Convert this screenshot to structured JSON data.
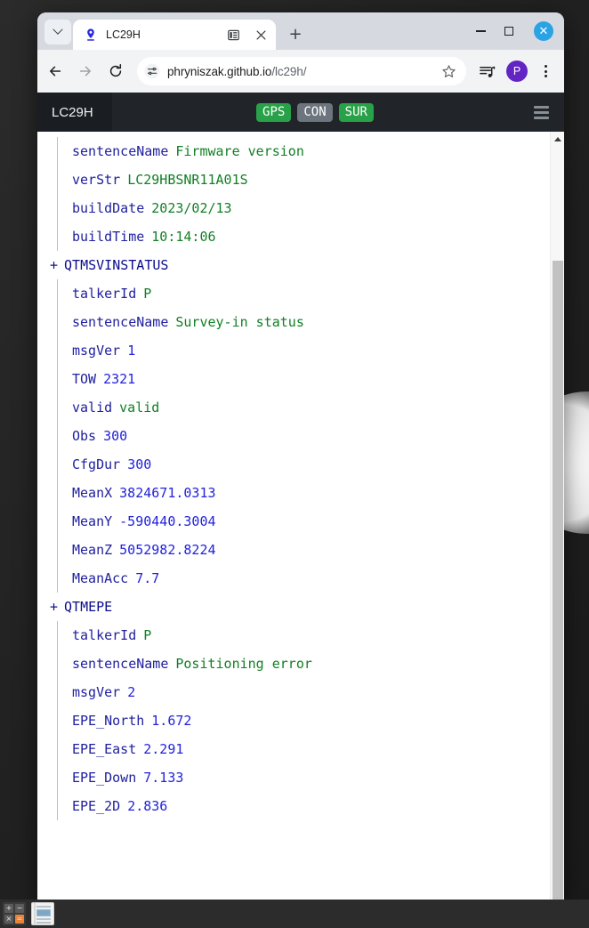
{
  "browser": {
    "tab": {
      "title": "LC29H",
      "favicon": "location-pin-icon",
      "split_label": "☰",
      "close_label": "✕"
    },
    "new_tab_label": "+",
    "window_controls": {
      "minimize": "minimize-icon",
      "maximize": "maximize-icon",
      "close": "✕"
    },
    "toolbar": {
      "back": "back-arrow-icon",
      "forward": "forward-arrow-icon",
      "reload": "reload-icon",
      "site_settings": "tune-sliders-icon",
      "url_host": "phryniszak.github.io",
      "url_path": "/lc29h/",
      "bookmark": "star-icon",
      "reading_list": "reading-list-icon",
      "profile_initial": "P",
      "menu": "three-dot-menu-icon"
    }
  },
  "app": {
    "brand": "LC29H",
    "badges": [
      {
        "label": "GPS",
        "color": "#28a148"
      },
      {
        "label": "CON",
        "color": "#6c757d"
      },
      {
        "label": "SUR",
        "color": "#28a148"
      }
    ],
    "menu_toggle": "hamburger-icon"
  },
  "tree": {
    "partial_group": {
      "rows": [
        {
          "key": "sentenceName",
          "value": "Firmware version",
          "type": "str"
        },
        {
          "key": "verStr",
          "value": "LC29HBSNR11A01S",
          "type": "str"
        },
        {
          "key": "buildDate",
          "value": "2023/02/13",
          "type": "str"
        },
        {
          "key": "buildTime",
          "value": "10:14:06",
          "type": "str"
        }
      ]
    },
    "groups": [
      {
        "toggle": "+",
        "name": "QTMSVINSTATUS",
        "rows": [
          {
            "key": "talkerId",
            "value": "P",
            "type": "str"
          },
          {
            "key": "sentenceName",
            "value": "Survey-in status",
            "type": "str"
          },
          {
            "key": "msgVer",
            "value": "1",
            "type": "num"
          },
          {
            "key": "TOW",
            "value": "2321",
            "type": "num"
          },
          {
            "key": "valid",
            "value": "valid",
            "type": "str"
          },
          {
            "key": "Obs",
            "value": "300",
            "type": "num"
          },
          {
            "key": "CfgDur",
            "value": "300",
            "type": "num"
          },
          {
            "key": "MeanX",
            "value": "3824671.0313",
            "type": "num"
          },
          {
            "key": "MeanY",
            "value": "-590440.3004",
            "type": "num"
          },
          {
            "key": "MeanZ",
            "value": "5052982.8224",
            "type": "num"
          },
          {
            "key": "MeanAcc",
            "value": "7.7",
            "type": "num"
          }
        ]
      },
      {
        "toggle": "+",
        "name": "QTMEPE",
        "rows": [
          {
            "key": "talkerId",
            "value": "P",
            "type": "str"
          },
          {
            "key": "sentenceName",
            "value": "Positioning error",
            "type": "str"
          },
          {
            "key": "msgVer",
            "value": "2",
            "type": "num"
          },
          {
            "key": "EPE_North",
            "value": "1.672",
            "type": "num"
          },
          {
            "key": "EPE_East",
            "value": "2.291",
            "type": "num"
          },
          {
            "key": "EPE_Down",
            "value": "7.133",
            "type": "num"
          },
          {
            "key": "EPE_2D",
            "value": "2.836",
            "type": "num"
          }
        ]
      }
    ]
  },
  "taskbar": {
    "items": [
      {
        "icon": "calculator-icon",
        "keys": [
          "+",
          "−",
          "×",
          "="
        ]
      },
      {
        "icon": "document-window-icon"
      }
    ]
  }
}
